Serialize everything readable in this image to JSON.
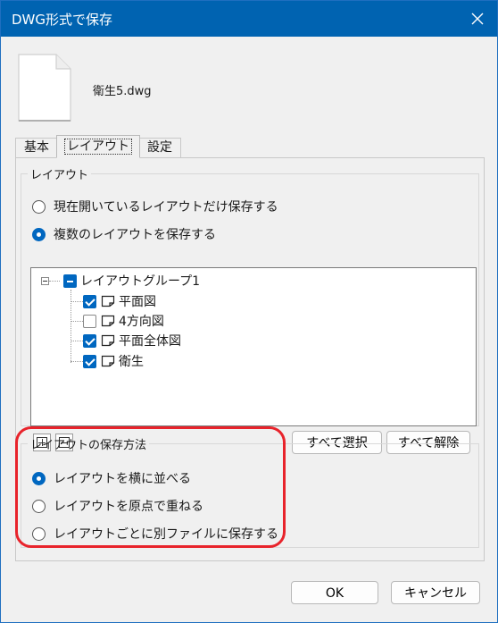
{
  "window": {
    "title": "DWG形式で保存"
  },
  "file": {
    "name": "衛生5.dwg"
  },
  "tabs": [
    {
      "label": "基本"
    },
    {
      "label": "レイアウト"
    },
    {
      "label": "設定"
    }
  ],
  "layout_group": {
    "legend": "レイアウト",
    "options": [
      {
        "label": "現在開いているレイアウトだけ保存する",
        "selected": false
      },
      {
        "label": "複数のレイアウトを保存する",
        "selected": true
      }
    ],
    "tree": {
      "root": {
        "label": "レイアウトグループ1",
        "check": "partial"
      },
      "children": [
        {
          "label": "平面図",
          "checked": true
        },
        {
          "label": "4方向図",
          "checked": false
        },
        {
          "label": "平面全体図",
          "checked": true
        },
        {
          "label": "衛生",
          "checked": true
        }
      ]
    },
    "buttons": {
      "select_all": "すべて選択",
      "deselect_all": "すべて解除"
    }
  },
  "save_method": {
    "legend": "レイアウトの保存方法",
    "options": [
      {
        "label": "レイアウトを横に並べる",
        "selected": true
      },
      {
        "label": "レイアウトを原点で重ねる",
        "selected": false
      },
      {
        "label": "レイアウトごとに別ファイルに保存する",
        "selected": false
      }
    ]
  },
  "footer": {
    "ok": "OK",
    "cancel": "キャンセル"
  },
  "colors": {
    "accent": "#0067c0",
    "titlebar": "#0063b1",
    "highlight": "#e8232b"
  }
}
